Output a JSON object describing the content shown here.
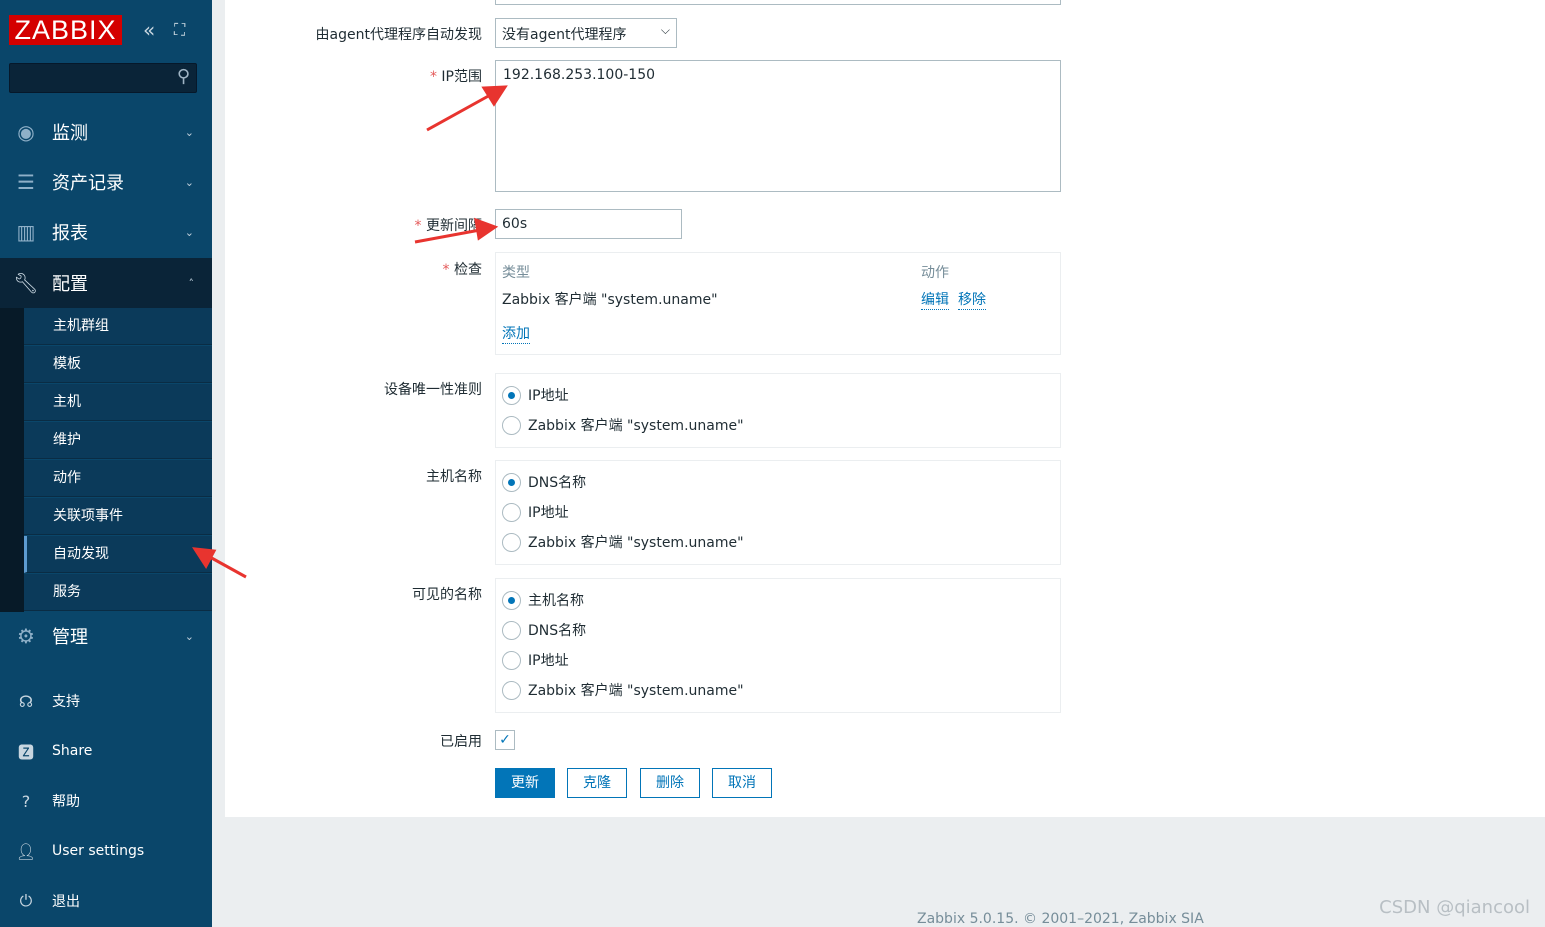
{
  "sidebar": {
    "logo": "ZABBIX",
    "search_placeholder": "",
    "menu": [
      {
        "label": "监测",
        "icon": "eye-icon"
      },
      {
        "label": "资产记录",
        "icon": "list-icon"
      },
      {
        "label": "报表",
        "icon": "bar-chart-icon"
      },
      {
        "label": "配置",
        "icon": "wrench-icon"
      },
      {
        "label": "管理",
        "icon": "gear-icon"
      }
    ],
    "submenu": [
      "主机群组",
      "模板",
      "主机",
      "维护",
      "动作",
      "关联项事件",
      "自动发现",
      "服务"
    ],
    "active_sub": "自动发现",
    "bottom": [
      {
        "label": "支持",
        "icon": "headset-icon"
      },
      {
        "label": "Share",
        "icon": "zabbix-share-icon"
      },
      {
        "label": "帮助",
        "icon": "help-icon"
      },
      {
        "label": "User settings",
        "icon": "user-icon"
      },
      {
        "label": "退出",
        "icon": "power-icon"
      }
    ]
  },
  "form": {
    "proxy_label": "由agent代理程序自动发现",
    "proxy_value": "没有agent代理程序",
    "ip_label": "IP范围",
    "ip_value": "192.168.253.100-150",
    "interval_label": "更新间隔",
    "interval_value": "60s",
    "checks_label": "检查",
    "checks_col_type": "类型",
    "checks_col_action": "动作",
    "check_row": "Zabbix 客户端 \"system.uname\"",
    "edit": "编辑",
    "remove": "移除",
    "add": "添加",
    "uniq_label": "设备唯一性准则",
    "uniq_options": [
      "IP地址",
      "Zabbix 客户端 \"system.uname\""
    ],
    "uniq_selected": 0,
    "host_label": "主机名称",
    "host_options": [
      "DNS名称",
      "IP地址",
      "Zabbix 客户端 \"system.uname\""
    ],
    "host_selected": 0,
    "visible_label": "可见的名称",
    "visible_options": [
      "主机名称",
      "DNS名称",
      "IP地址",
      "Zabbix 客户端 \"system.uname\""
    ],
    "visible_selected": 0,
    "enabled_label": "已启用",
    "enabled": true,
    "buttons": {
      "update": "更新",
      "clone": "克隆",
      "delete": "删除",
      "cancel": "取消"
    }
  },
  "footer": "Zabbix 5.0.15. © 2001–2021, Zabbix SIA",
  "watermark": "CSDN @qiancool",
  "colors": {
    "sidebar": "#0a466a",
    "accent": "#0275b8",
    "logo": "#d40000",
    "annotation_arrow": "#e8342f"
  }
}
